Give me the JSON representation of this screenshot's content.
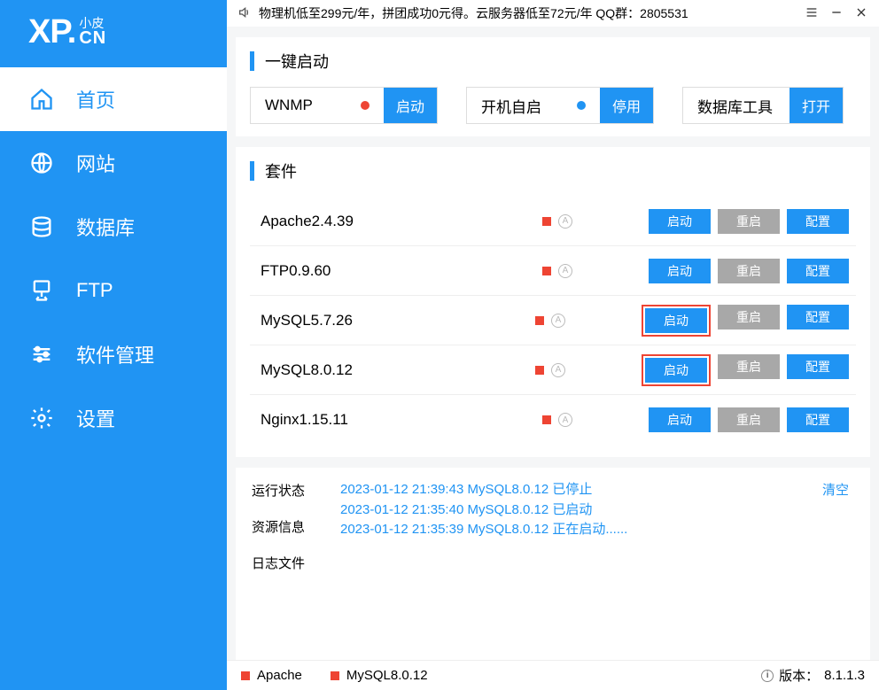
{
  "brand": {
    "xp": "XP.",
    "small": "小皮",
    "cn": "CN"
  },
  "announcement": "物理机低至299元/年，拼团成功0元得。云服务器低至72元/年  QQ群：2805531",
  "nav": {
    "home": {
      "label": "首页"
    },
    "site": {
      "label": "网站"
    },
    "db": {
      "label": "数据库"
    },
    "ftp": {
      "label": "FTP"
    },
    "soft": {
      "label": "软件管理"
    },
    "set": {
      "label": "设置"
    }
  },
  "sections": {
    "quick": "一键启动",
    "suite": "套件"
  },
  "quick": {
    "wnmp": {
      "label": "WNMP",
      "btn": "启动"
    },
    "boot": {
      "label": "开机自启",
      "btn": "停用"
    },
    "dbtool": {
      "label": "数据库工具",
      "btn": "打开"
    }
  },
  "suites": [
    {
      "name": "Apache2.4.39",
      "start": "启动",
      "restart": "重启",
      "config": "配置",
      "hi": false
    },
    {
      "name": "FTP0.9.60",
      "start": "启动",
      "restart": "重启",
      "config": "配置",
      "hi": false
    },
    {
      "name": "MySQL5.7.26",
      "start": "启动",
      "restart": "重启",
      "config": "配置",
      "hi": true
    },
    {
      "name": "MySQL8.0.12",
      "start": "启动",
      "restart": "重启",
      "config": "配置",
      "hi": true
    },
    {
      "name": "Nginx1.15.11",
      "start": "启动",
      "restart": "重启",
      "config": "配置",
      "hi": false
    }
  ],
  "log": {
    "tabs": {
      "status": "运行状态",
      "res": "资源信息",
      "file": "日志文件"
    },
    "lines": [
      "2023-01-12 21:39:43 MySQL8.0.12 已停止",
      "2023-01-12 21:35:40 MySQL8.0.12 已启动",
      "2023-01-12 21:35:39 MySQL8.0.12 正在启动......"
    ],
    "clear": "清空"
  },
  "status": {
    "apache": "Apache",
    "mysql": "MySQL8.0.12",
    "version_label": "版本：",
    "version": "8.1.1.3"
  }
}
